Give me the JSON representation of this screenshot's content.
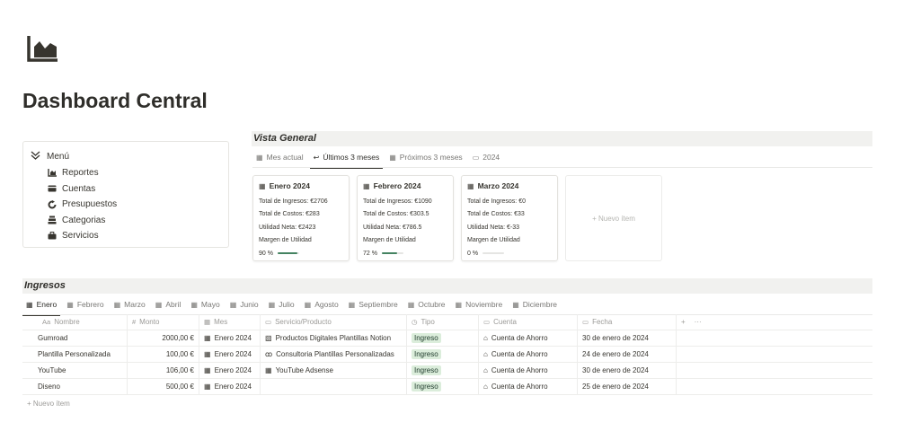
{
  "page": {
    "title": "Dashboard Central",
    "logo_icon": "chart-area-icon"
  },
  "menu": {
    "label": "Menú",
    "items": [
      {
        "label": "Reportes",
        "icon": "chart-icon"
      },
      {
        "label": "Cuentas",
        "icon": "credit-card-icon"
      },
      {
        "label": "Presupuestos",
        "icon": "refresh-icon"
      },
      {
        "label": "Categorias",
        "icon": "stack-icon"
      },
      {
        "label": "Servicios",
        "icon": "briefcase-icon"
      }
    ]
  },
  "vista": {
    "title": "Vista General",
    "tabs": [
      {
        "label": "Mes actual",
        "icon": "table-icon"
      },
      {
        "label": "Últimos 3 meses",
        "icon": "reply-icon",
        "active": true
      },
      {
        "label": "Próximos 3 meses",
        "icon": "calendar-icon"
      },
      {
        "label": "2024",
        "icon": "calendar-icon"
      }
    ],
    "cards": [
      {
        "title": "Enero 2024",
        "ingresos": "Total de Ingresos: €2706",
        "costos": "Total de Costos: €283",
        "utilidad": "Utilidad Neta: €2423",
        "margen_label": "Margen de Utilidad",
        "margen": "90 %",
        "margen_value": 0.9
      },
      {
        "title": "Febrero 2024",
        "ingresos": "Total de Ingresos: €1090",
        "costos": "Total de Costos: €303.5",
        "utilidad": "Utilidad Neta: €786.5",
        "margen_label": "Margen de Utilidad",
        "margen": "72 %",
        "margen_value": 0.72
      },
      {
        "title": "Marzo 2024",
        "ingresos": "Total de Ingresos: €0",
        "costos": "Total de Costos: €33",
        "utilidad": "Utilidad Neta: €-33",
        "margen_label": "Margen de Utilidad",
        "margen": "0 %",
        "margen_value": 0
      }
    ],
    "new_item": "+ Nuevo ítem"
  },
  "ingresos": {
    "title": "Ingresos",
    "tabs": [
      "Enero",
      "Febrero",
      "Marzo",
      "Abril",
      "Mayo",
      "Junio",
      "Julio",
      "Agosto",
      "Septiembre",
      "Octubre",
      "Noviembre",
      "Diciembre"
    ],
    "active_tab": "Enero",
    "columns": [
      {
        "label": "Nombre",
        "icon": "Aa"
      },
      {
        "label": "Monto",
        "icon": "#"
      },
      {
        "label": "Mes",
        "icon": "calendar-icon"
      },
      {
        "label": "Servicio/Producto",
        "icon": "briefcase-icon"
      },
      {
        "label": "Tipo",
        "icon": "circle-icon"
      },
      {
        "label": "Cuenta",
        "icon": "credit-card-icon"
      },
      {
        "label": "Fecha",
        "icon": "calendar-icon"
      }
    ],
    "rows": [
      {
        "nombre": "Gumroad",
        "monto": "2000,00 €",
        "mes": "Enero 2024",
        "servicio": "Productos Digitales Plantillas Notion",
        "servicio_icon": "document-icon",
        "tipo": "Ingreso",
        "cuenta": "Cuenta de Ahorro",
        "fecha": "30 de enero de 2024"
      },
      {
        "nombre": "Plantilla Personalizada",
        "monto": "100,00 €",
        "mes": "Enero 2024",
        "servicio": "Consultoria Plantillas Personalizadas",
        "servicio_icon": "glasses-icon",
        "tipo": "Ingreso",
        "cuenta": "Cuenta de Ahorro",
        "fecha": "24 de enero de 2024"
      },
      {
        "nombre": "YouTube",
        "monto": "106,00 €",
        "mes": "Enero 2024",
        "servicio": "YouTube Adsense",
        "servicio_icon": "video-icon",
        "tipo": "Ingreso",
        "cuenta": "Cuenta de Ahorro",
        "fecha": "30 de enero de 2024"
      },
      {
        "nombre": "Diseno",
        "monto": "500,00 €",
        "mes": "Enero 2024",
        "servicio": "",
        "servicio_icon": "",
        "tipo": "Ingreso",
        "cuenta": "Cuenta de Ahorro",
        "fecha": "25 de enero de 2024"
      }
    ],
    "new_item": "+ Nuevo ítem"
  },
  "colors": {
    "accent_green": "#448361",
    "tag_bg": "#dbeddb",
    "section_bg": "#f1f1ef"
  }
}
